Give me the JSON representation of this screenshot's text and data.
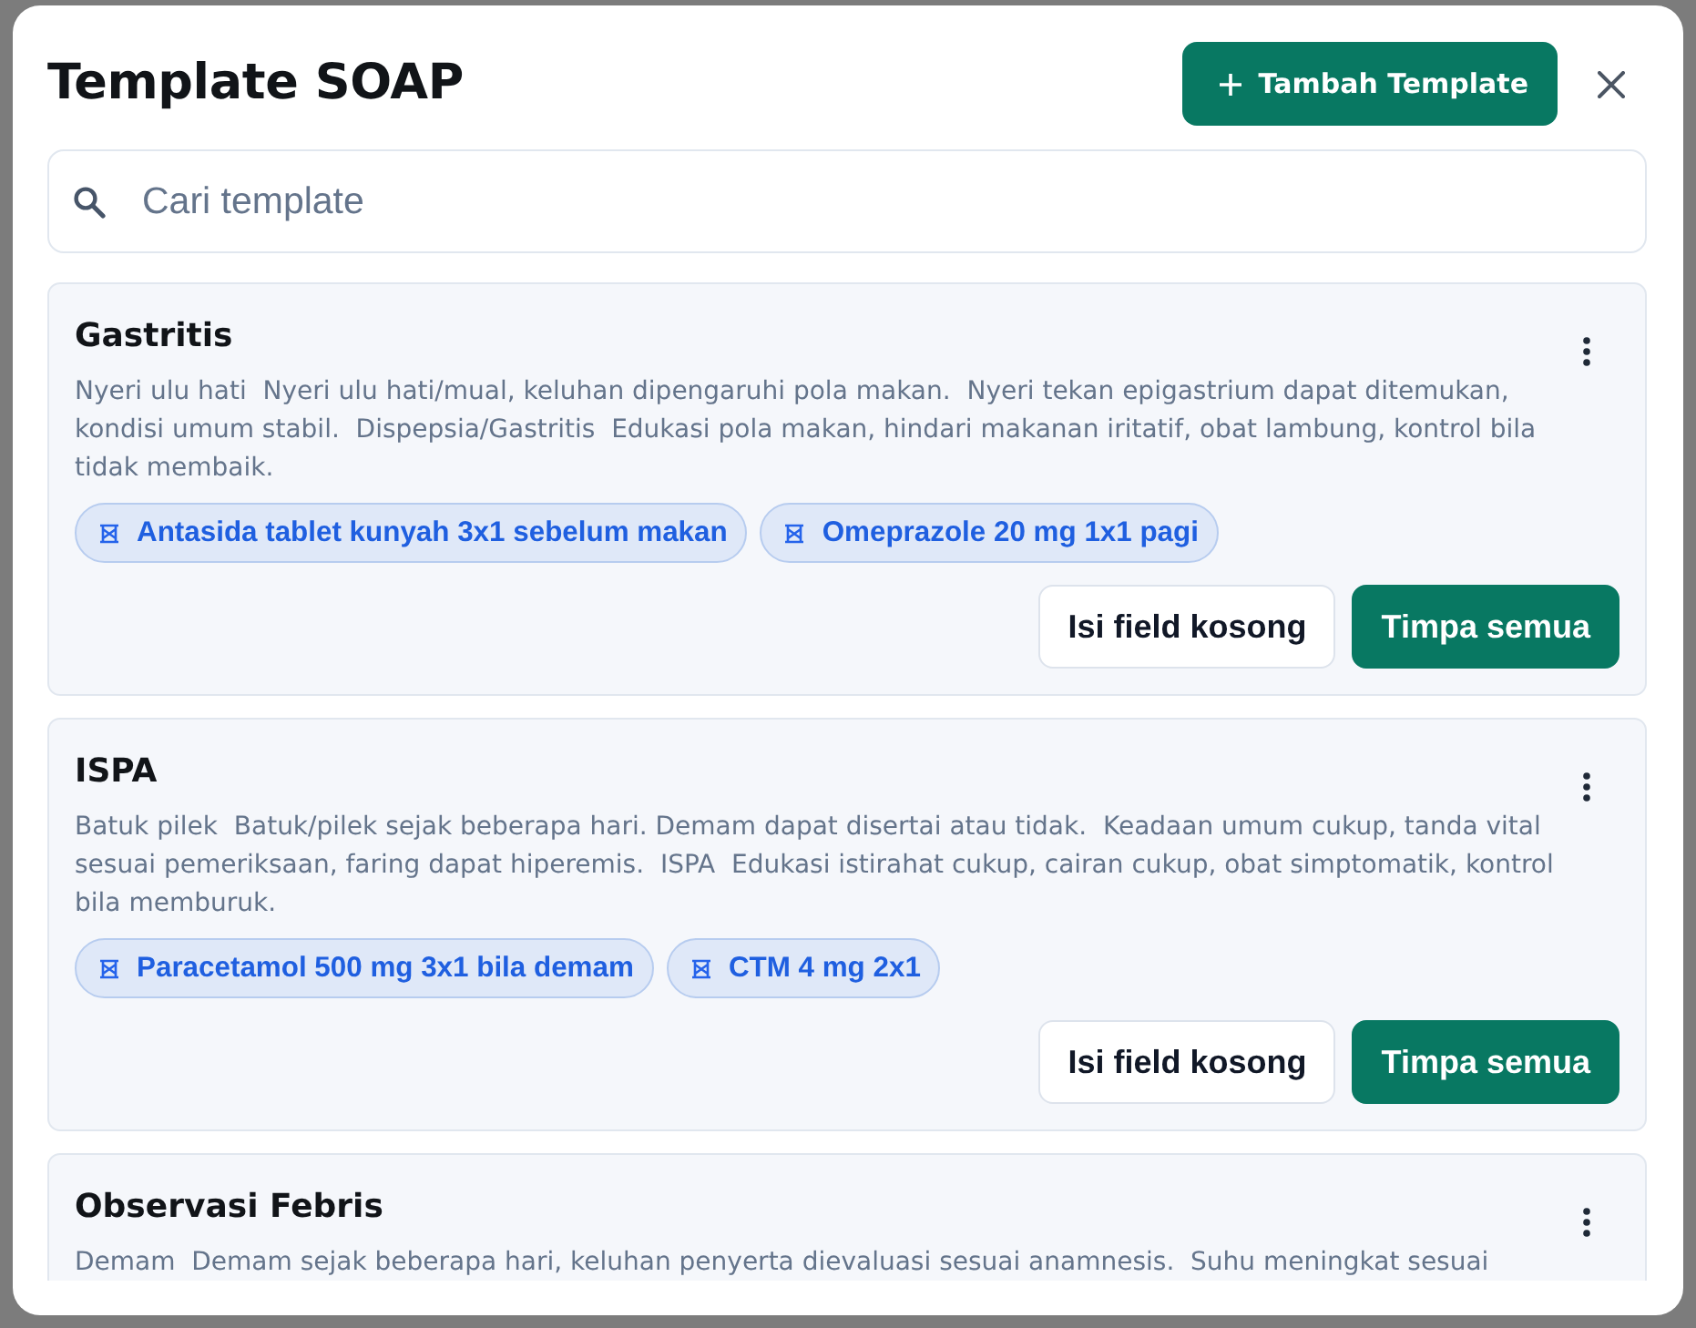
{
  "dialog": {
    "title": "Template SOAP",
    "add_button": {
      "label": "Tambah Template"
    }
  },
  "search": {
    "placeholder": "Cari template"
  },
  "templates": [
    {
      "name": "Gastritis",
      "summary": "Nyeri ulu hati  Nyeri ulu hati/mual, keluhan dipengaruhi pola makan.  Nyeri tekan epigastrium dapat ditemukan, kondisi umum stabil.  Dispepsia/Gastritis  Edukasi pola makan, hindari makanan iritatif, obat lambung, kontrol bila tidak membaik.",
      "medications": [
        "Antasida tablet kunyah 3x1 sebelum makan",
        "Omeprazole 20 mg 1x1 pagi"
      ],
      "buttons": [
        {
          "label": "Isi field kosong",
          "kind": "fill_empty"
        },
        {
          "label": "Timpa semua",
          "kind": "overwrite"
        }
      ]
    },
    {
      "name": "ISPA",
      "summary": "Batuk pilek  Batuk/pilek sejak beberapa hari. Demam dapat disertai atau tidak.  Keadaan umum cukup, tanda vital sesuai pemeriksaan, faring dapat hiperemis.  ISPA  Edukasi istirahat cukup, cairan cukup, obat simptomatik, kontrol bila memburuk.",
      "medications": [
        "Paracetamol 500 mg 3x1 bila demam",
        "CTM 4 mg 2x1"
      ],
      "buttons": [
        {
          "label": "Isi field kosong",
          "kind": "fill_empty"
        },
        {
          "label": "Timpa semua",
          "kind": "overwrite"
        }
      ]
    },
    {
      "name": "Observasi Febris",
      "summary": "Demam  Demam sejak beberapa hari, keluhan penyerta dievaluasi sesuai anamnesis.  Suhu meningkat sesuai"
    }
  ]
}
